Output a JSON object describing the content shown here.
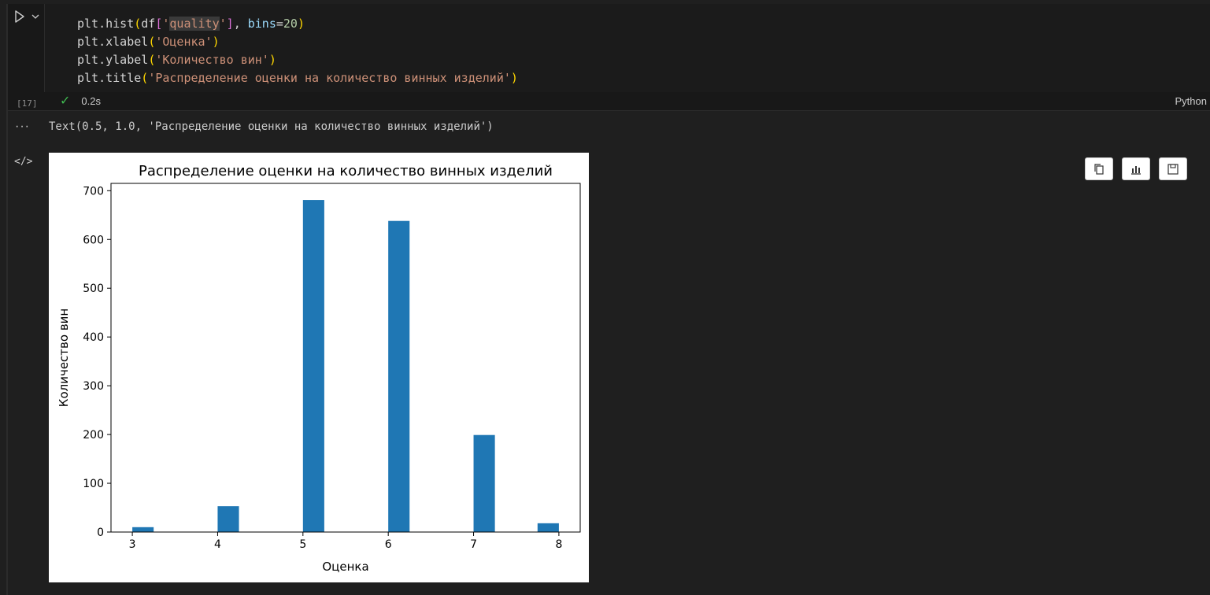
{
  "cell": {
    "execution_count": "[17]",
    "duration": "0.2s",
    "language": "Python",
    "code_lines": [
      [
        {
          "t": "plt.hist",
          "c": "plain"
        },
        {
          "t": "(",
          "c": "p1"
        },
        {
          "t": "df",
          "c": "plain"
        },
        {
          "t": "[",
          "c": "p2"
        },
        {
          "t": "'",
          "c": "str"
        },
        {
          "t": "quality",
          "c": "str hl"
        },
        {
          "t": "'",
          "c": "str"
        },
        {
          "t": "]",
          "c": "p2"
        },
        {
          "t": ", ",
          "c": "plain"
        },
        {
          "t": "bins",
          "c": "kw"
        },
        {
          "t": "=",
          "c": "plain"
        },
        {
          "t": "20",
          "c": "num"
        },
        {
          "t": ")",
          "c": "p1"
        }
      ],
      [
        {
          "t": "plt.xlabel",
          "c": "plain"
        },
        {
          "t": "(",
          "c": "p1"
        },
        {
          "t": "'Оценка'",
          "c": "str"
        },
        {
          "t": ")",
          "c": "p1"
        }
      ],
      [
        {
          "t": "plt.ylabel",
          "c": "plain"
        },
        {
          "t": "(",
          "c": "p1"
        },
        {
          "t": "'Количество вин'",
          "c": "str"
        },
        {
          "t": ")",
          "c": "p1"
        }
      ],
      [
        {
          "t": "plt.title",
          "c": "plain"
        },
        {
          "t": "(",
          "c": "p1"
        },
        {
          "t": "'Распределение оценки на количество винных изделий'",
          "c": "str"
        },
        {
          "t": ")",
          "c": "p1"
        }
      ]
    ]
  },
  "output": {
    "text": "Text(0.5, 1.0, 'Распределение оценки на количество винных изделий')",
    "dots": "···",
    "code_icon": "</>"
  },
  "toolbar": {
    "buttons": [
      "copy-icon",
      "chart-icon",
      "save-icon"
    ]
  },
  "chart_data": {
    "type": "bar",
    "title": "Распределение оценки на количество винных изделий",
    "xlabel": "Оценка",
    "ylabel": "Количество вин",
    "xlim": [
      2.75,
      8.25
    ],
    "ylim": [
      0,
      715
    ],
    "xticks": [
      3,
      4,
      5,
      6,
      7,
      8
    ],
    "yticks": [
      0,
      100,
      200,
      300,
      400,
      500,
      600,
      700
    ],
    "bar_color": "#1f77b4",
    "bin_width": 0.25,
    "bins_left": [
      3.0,
      4.0,
      5.0,
      6.0,
      7.0,
      7.75
    ],
    "values": [
      10,
      53,
      681,
      638,
      199,
      18
    ]
  }
}
